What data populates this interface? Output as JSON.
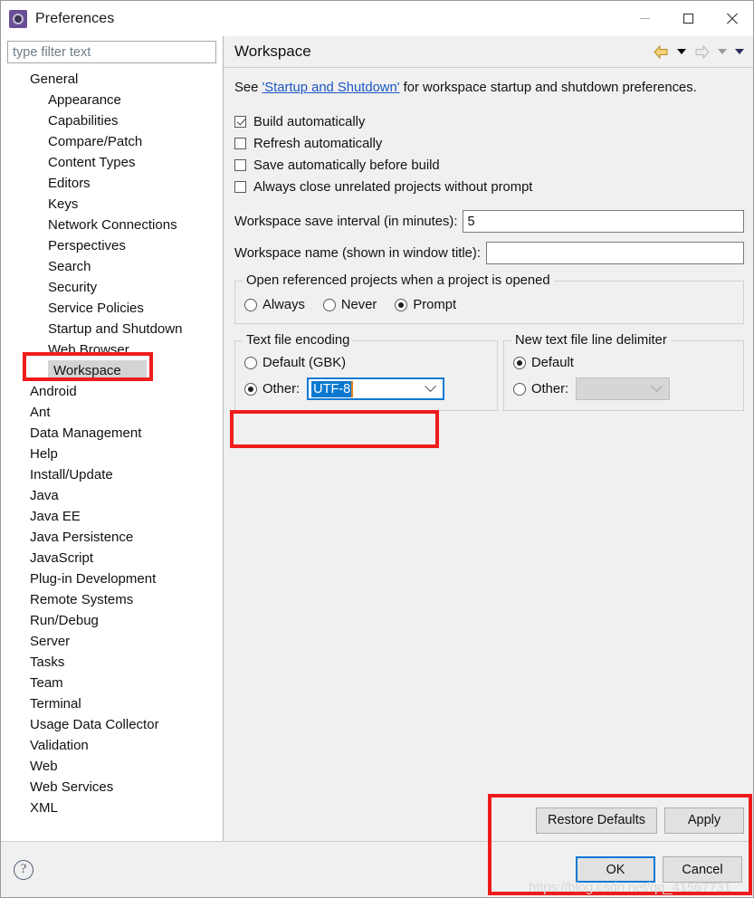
{
  "window": {
    "title": "Preferences",
    "icon": "preferences-gear-icon",
    "controls": {
      "minimize": "minimize-icon",
      "maximize": "maximize-icon",
      "close": "close-icon"
    }
  },
  "sidebar": {
    "filter": {
      "placeholder": "type filter text",
      "value": ""
    },
    "items": [
      {
        "label": "General",
        "level": 1,
        "selected": false
      },
      {
        "label": "Appearance",
        "level": 2,
        "selected": false
      },
      {
        "label": "Capabilities",
        "level": 2,
        "selected": false
      },
      {
        "label": "Compare/Patch",
        "level": 2,
        "selected": false
      },
      {
        "label": "Content Types",
        "level": 2,
        "selected": false
      },
      {
        "label": "Editors",
        "level": 2,
        "selected": false
      },
      {
        "label": "Keys",
        "level": 2,
        "selected": false
      },
      {
        "label": "Network Connections",
        "level": 2,
        "selected": false
      },
      {
        "label": "Perspectives",
        "level": 2,
        "selected": false
      },
      {
        "label": "Search",
        "level": 2,
        "selected": false
      },
      {
        "label": "Security",
        "level": 2,
        "selected": false
      },
      {
        "label": "Service Policies",
        "level": 2,
        "selected": false
      },
      {
        "label": "Startup and Shutdown",
        "level": 2,
        "selected": false
      },
      {
        "label": "Web Browser",
        "level": 2,
        "selected": false
      },
      {
        "label": "Workspace",
        "level": 2,
        "selected": true
      },
      {
        "label": "Android",
        "level": 1,
        "selected": false
      },
      {
        "label": "Ant",
        "level": 1,
        "selected": false
      },
      {
        "label": "Data Management",
        "level": 1,
        "selected": false
      },
      {
        "label": "Help",
        "level": 1,
        "selected": false
      },
      {
        "label": "Install/Update",
        "level": 1,
        "selected": false
      },
      {
        "label": "Java",
        "level": 1,
        "selected": false
      },
      {
        "label": "Java EE",
        "level": 1,
        "selected": false
      },
      {
        "label": "Java Persistence",
        "level": 1,
        "selected": false
      },
      {
        "label": "JavaScript",
        "level": 1,
        "selected": false
      },
      {
        "label": "Plug-in Development",
        "level": 1,
        "selected": false
      },
      {
        "label": "Remote Systems",
        "level": 1,
        "selected": false
      },
      {
        "label": "Run/Debug",
        "level": 1,
        "selected": false
      },
      {
        "label": "Server",
        "level": 1,
        "selected": false
      },
      {
        "label": "Tasks",
        "level": 1,
        "selected": false
      },
      {
        "label": "Team",
        "level": 1,
        "selected": false
      },
      {
        "label": "Terminal",
        "level": 1,
        "selected": false
      },
      {
        "label": "Usage Data Collector",
        "level": 1,
        "selected": false
      },
      {
        "label": "Validation",
        "level": 1,
        "selected": false
      },
      {
        "label": "Web",
        "level": 1,
        "selected": false
      },
      {
        "label": "Web Services",
        "level": 1,
        "selected": false
      },
      {
        "label": "XML",
        "level": 1,
        "selected": false
      }
    ]
  },
  "page": {
    "title": "Workspace",
    "nav": {
      "back_icon": "back-arrow-icon",
      "back_menu_icon": "chevron-down-icon",
      "forward_icon": "forward-arrow-icon",
      "forward_menu_icon": "chevron-down-icon",
      "view_menu_icon": "chevron-down-icon"
    },
    "description": {
      "prefix": "See ",
      "link": "'Startup and Shutdown'",
      "suffix": " for workspace startup and shutdown preferences."
    },
    "checkboxes": [
      {
        "label": "Build automatically",
        "checked": true
      },
      {
        "label": "Refresh automatically",
        "checked": false
      },
      {
        "label": "Save automatically before build",
        "checked": false
      },
      {
        "label": "Always close unrelated projects without prompt",
        "checked": false
      }
    ],
    "fields": [
      {
        "label": "Workspace save interval (in minutes):",
        "value": "5",
        "placeholder": ""
      },
      {
        "label": "Workspace name (shown in window title):",
        "value": "",
        "placeholder": ""
      }
    ],
    "open_referenced": {
      "legend": "Open referenced projects when a project is opened",
      "options": [
        {
          "label": "Always",
          "selected": false
        },
        {
          "label": "Never",
          "selected": false
        },
        {
          "label": "Prompt",
          "selected": true
        }
      ]
    },
    "text_file_encoding": {
      "legend": "Text file encoding",
      "default_option": {
        "label": "Default (GBK)",
        "selected": false
      },
      "other_option": {
        "label": "Other:",
        "selected": true
      },
      "combo_value": "UTF-8",
      "combo_enabled": true
    },
    "line_delimiter": {
      "legend": "New text file line delimiter",
      "default_option": {
        "label": "Default",
        "selected": true
      },
      "other_option": {
        "label": "Other:",
        "selected": false
      },
      "combo_value": "",
      "combo_enabled": false
    }
  },
  "footer": {
    "restore_defaults": "Restore Defaults",
    "apply": "Apply",
    "ok": "OK",
    "cancel": "Cancel",
    "help_icon": "help-question-icon",
    "watermark": "https://blog.csdn.net/qq_41567731"
  },
  "colors": {
    "accent": "#0a7ad4",
    "annotation": "#ef1c1c",
    "link": "#1a56c4",
    "selection": "#0b78d0"
  }
}
